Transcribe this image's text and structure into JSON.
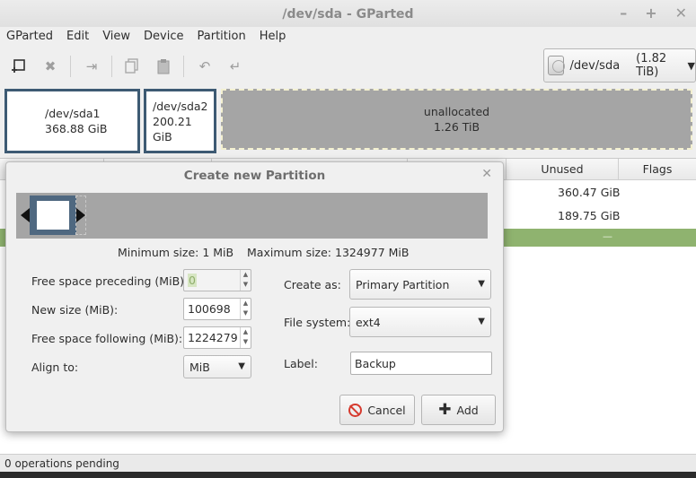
{
  "window": {
    "title": "/dev/sda - GParted",
    "controls": [
      "–",
      "+",
      "✕"
    ]
  },
  "menubar": {
    "items": [
      "GParted",
      "Edit",
      "View",
      "Device",
      "Partition",
      "Help"
    ]
  },
  "device_selector": {
    "device": "/dev/sda",
    "size": "(1.82 TiB)"
  },
  "disk_map": {
    "partitions": [
      {
        "name": "/dev/sda1",
        "size": "368.88 GiB"
      },
      {
        "name": "/dev/sda2",
        "size": "200.21 GiB"
      }
    ],
    "unallocated": {
      "name": "unallocated",
      "size": "1.26 TiB"
    }
  },
  "table": {
    "columns_visible": [
      "Unused",
      "Flags"
    ],
    "rows": [
      {
        "unused": "360.47 GiB"
      },
      {
        "unused": "189.75 GiB"
      }
    ],
    "green_row_text": "—"
  },
  "statusbar": {
    "text": "0 operations pending"
  },
  "dialog": {
    "title": "Create new Partition",
    "min_size": "Minimum size: 1 MiB",
    "max_size": "Maximum size: 1324977 MiB",
    "fields": {
      "free_preceding": {
        "label": "Free space preceding (MiB):",
        "value": "0"
      },
      "new_size": {
        "label": "New size (MiB):",
        "value": "100698"
      },
      "free_following": {
        "label": "Free space following (MiB):",
        "value": "1224279"
      },
      "align_to": {
        "label": "Align to:",
        "value": "MiB"
      },
      "create_as": {
        "label": "Create as:",
        "value": "Primary Partition"
      },
      "file_system": {
        "label": "File system:",
        "value": "ext4"
      },
      "partition_label": {
        "label": "Label:",
        "value": "Backup"
      }
    },
    "buttons": {
      "cancel": "Cancel",
      "add": "Add"
    }
  }
}
